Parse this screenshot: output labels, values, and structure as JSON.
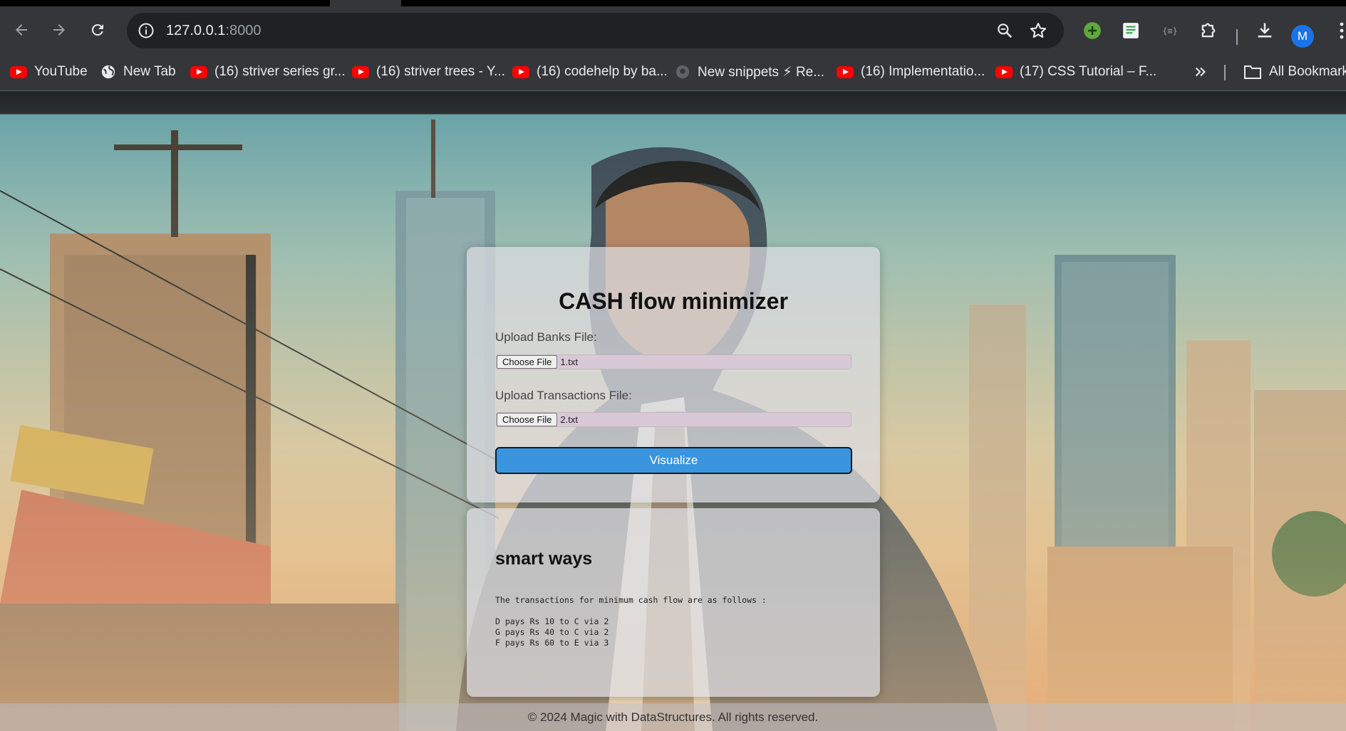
{
  "browser": {
    "url_host": "127.0.0.1",
    "url_port": ":8000",
    "avatar_initial": "M",
    "bookmarks": [
      {
        "label": "YouTube",
        "icon": "youtube-icon"
      },
      {
        "label": "New Tab",
        "icon": "globe-icon"
      },
      {
        "label": "(16) striver series gr...",
        "icon": "youtube-icon"
      },
      {
        "label": "(16) striver trees - Y...",
        "icon": "youtube-icon"
      },
      {
        "label": "(16) codehelp by ba...",
        "icon": "youtube-icon"
      },
      {
        "label": "New snippets ⚡ Re...",
        "icon": "github-icon"
      },
      {
        "label": "(16) Implementatio...",
        "icon": "youtube-icon"
      },
      {
        "label": "(17) CSS Tutorial – F...",
        "icon": "youtube-icon"
      }
    ],
    "all_bookmarks_label": "All Bookmarks"
  },
  "upload": {
    "title": "CASH flow minimizer",
    "banks_label": "Upload Banks File:",
    "banks_button": "Choose File",
    "banks_file": "1.txt",
    "transactions_label": "Upload Transactions File:",
    "transactions_button": "Choose File",
    "transactions_file": "2.txt",
    "visualize_label": "Visualize"
  },
  "result": {
    "title": "smart ways",
    "intro": "The transactions for minimum cash flow are as follows :",
    "lines": [
      "D pays Rs 10 to C via 2",
      "G pays Rs 40 to C via 2",
      "F pays Rs 60 to E via 3"
    ]
  },
  "footer": {
    "text": "© 2024 Magic with DataStructures. All rights reserved."
  },
  "colors": {
    "accent": "#3a95de",
    "chrome": "#35363a"
  }
}
